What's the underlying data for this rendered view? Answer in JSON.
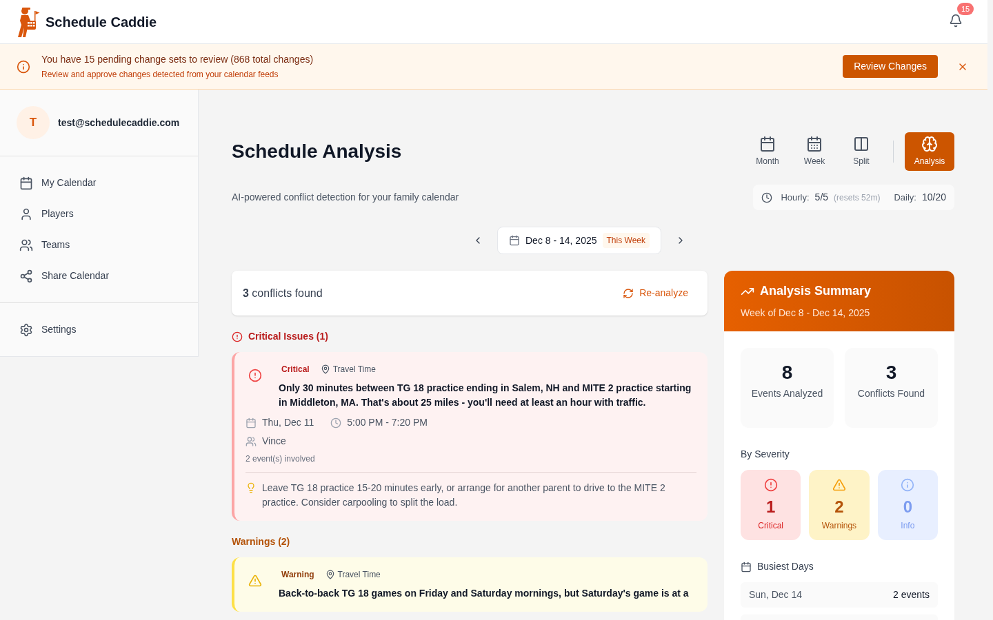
{
  "app": {
    "name": "Schedule Caddie",
    "notifications": "15"
  },
  "banner": {
    "title": "You have 15 pending change sets to review (868 total changes)",
    "subtitle": "Review and approve changes detected from your calendar feeds",
    "button": "Review Changes"
  },
  "user": {
    "initial": "T",
    "email": "test@schedulecaddie.com"
  },
  "nav_sections": [
    [
      {
        "kind": "calendar",
        "label": "My Calendar"
      },
      {
        "kind": "player",
        "label": "Players"
      },
      {
        "kind": "team",
        "label": "Teams"
      },
      {
        "kind": "share",
        "label": "Share Calendar"
      }
    ],
    [
      {
        "kind": "settings",
        "label": "Settings"
      }
    ]
  ],
  "page": {
    "title": "Schedule Analysis",
    "subtitle": "AI-powered conflict detection for your family calendar"
  },
  "views": [
    {
      "kind": "month",
      "label": "Month",
      "selected": false
    },
    {
      "kind": "week",
      "label": "Week",
      "selected": false
    },
    {
      "kind": "split",
      "label": "Split",
      "selected": false
    },
    {
      "kind": "analysis",
      "label": "Analysis",
      "selected": true
    }
  ],
  "usage": {
    "hourly_label": "Hourly:",
    "hourly": "5/5",
    "resets": "(resets 52m)",
    "daily_label": "Daily:",
    "daily": "10/20"
  },
  "week": {
    "range": "Dec 8 - 14, 2025",
    "badge": "This Week"
  },
  "conflicts_bar": {
    "count": "3",
    "label": "conflicts found",
    "action": "Re-analyze"
  },
  "groups": [
    {
      "kind": "critical",
      "heading": "Critical Issues (1)",
      "items": [
        {
          "severity": "Critical",
          "type": "Travel Time",
          "message": "Only 30 minutes between TG 18 practice ending in Salem, NH and MITE 2 practice starting in Middleton, MA. That's about 25 miles - you'll need at least an hour with traffic.",
          "date": "Thu, Dec 11",
          "time": "5:00 PM - 7:20 PM",
          "people": "Vince",
          "events": "2 event(s) involved",
          "suggestion": "Leave TG 18 practice 15-20 minutes early, or arrange for another parent to drive to the MITE 2 practice. Consider carpooling to split the load."
        }
      ]
    },
    {
      "kind": "warning",
      "heading": "Warnings (2)",
      "items": [
        {
          "severity": "Warning",
          "type": "Travel Time",
          "message": "Back-to-back TG 18 games on Friday and Saturday mornings, but Saturday's game is at a"
        }
      ]
    }
  ],
  "summary": {
    "title": "Analysis Summary",
    "subtitle": "Week of Dec 8 - Dec 14, 2025",
    "stats": [
      {
        "value": "8",
        "label": "Events Analyzed"
      },
      {
        "value": "3",
        "label": "Conflicts Found"
      }
    ],
    "severity_label": "By Severity",
    "severity": [
      {
        "kind": "critical",
        "value": "1",
        "label": "Critical"
      },
      {
        "kind": "warning",
        "value": "2",
        "label": "Warnings"
      },
      {
        "kind": "info",
        "value": "0",
        "label": "Info"
      }
    ],
    "busiest_label": "Busiest Days",
    "busiest_days": [
      {
        "day": "Sun, Dec 14",
        "count": "2 events"
      }
    ]
  }
}
